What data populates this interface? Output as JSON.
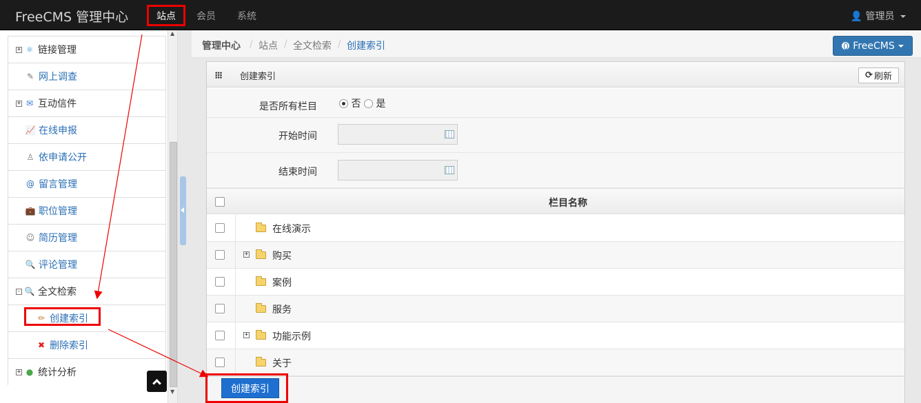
{
  "navbar": {
    "brand": "FreeCMS 管理中心",
    "items": [
      {
        "label": "站点",
        "active": true
      },
      {
        "label": "会员",
        "active": false
      },
      {
        "label": "系统",
        "active": false
      }
    ],
    "user": "管理员"
  },
  "sidebar": {
    "items": [
      {
        "label": "链接管理",
        "expand": "+",
        "icon": "atom-icon",
        "style": "plain"
      },
      {
        "label": "网上调查",
        "expand": "",
        "icon": "survey-icon",
        "style": "link"
      },
      {
        "label": "互动信件",
        "expand": "+",
        "icon": "mail-icon",
        "style": "plain"
      },
      {
        "label": "在线申报",
        "expand": "",
        "icon": "chart-icon",
        "style": "link"
      },
      {
        "label": "依申请公开",
        "expand": "",
        "icon": "person-icon",
        "style": "link"
      },
      {
        "label": "留言管理",
        "expand": "",
        "icon": "at-icon",
        "style": "link"
      },
      {
        "label": "职位管理",
        "expand": "",
        "icon": "job-icon",
        "style": "link"
      },
      {
        "label": "简历管理",
        "expand": "",
        "icon": "users-icon",
        "style": "link"
      },
      {
        "label": "评论管理",
        "expand": "",
        "icon": "comment-icon",
        "style": "link"
      },
      {
        "label": "全文检索",
        "expand": "-",
        "icon": "magnifier-icon",
        "style": "plain"
      },
      {
        "label": "创建索引",
        "expand": "",
        "icon": "pen-icon",
        "style": "link",
        "child": true
      },
      {
        "label": "删除索引",
        "expand": "",
        "icon": "delete-icon",
        "style": "link",
        "child": true
      },
      {
        "label": "统计分析",
        "expand": "+",
        "icon": "stats-icon",
        "style": "plain"
      }
    ]
  },
  "breadcrumb": {
    "items": [
      "管理中心",
      "站点",
      "全文检索",
      "创建索引"
    ],
    "sep": "/"
  },
  "site_button": {
    "label": "FreeCMS"
  },
  "panel": {
    "title": "创建索引",
    "refresh_label": "刷新",
    "all_channels_label": "是否所有栏目",
    "option_no": "否",
    "option_yes": "是",
    "start_label": "开始时间",
    "end_label": "结束时间",
    "start_value": "",
    "end_value": "",
    "column_header": "栏目名称",
    "rows": [
      {
        "name": "在线演示",
        "expandable": false
      },
      {
        "name": "购买",
        "expandable": true
      },
      {
        "name": "案例",
        "expandable": false
      },
      {
        "name": "服务",
        "expandable": false
      },
      {
        "name": "功能示例",
        "expandable": true
      },
      {
        "name": "关于",
        "expandable": false
      }
    ],
    "submit_label": "创建索引"
  },
  "colors": {
    "navbar_bg": "#1b1b1b",
    "link": "#2a6fb5",
    "primary_button": "#1e6fd0",
    "annotation": "#e00000"
  }
}
